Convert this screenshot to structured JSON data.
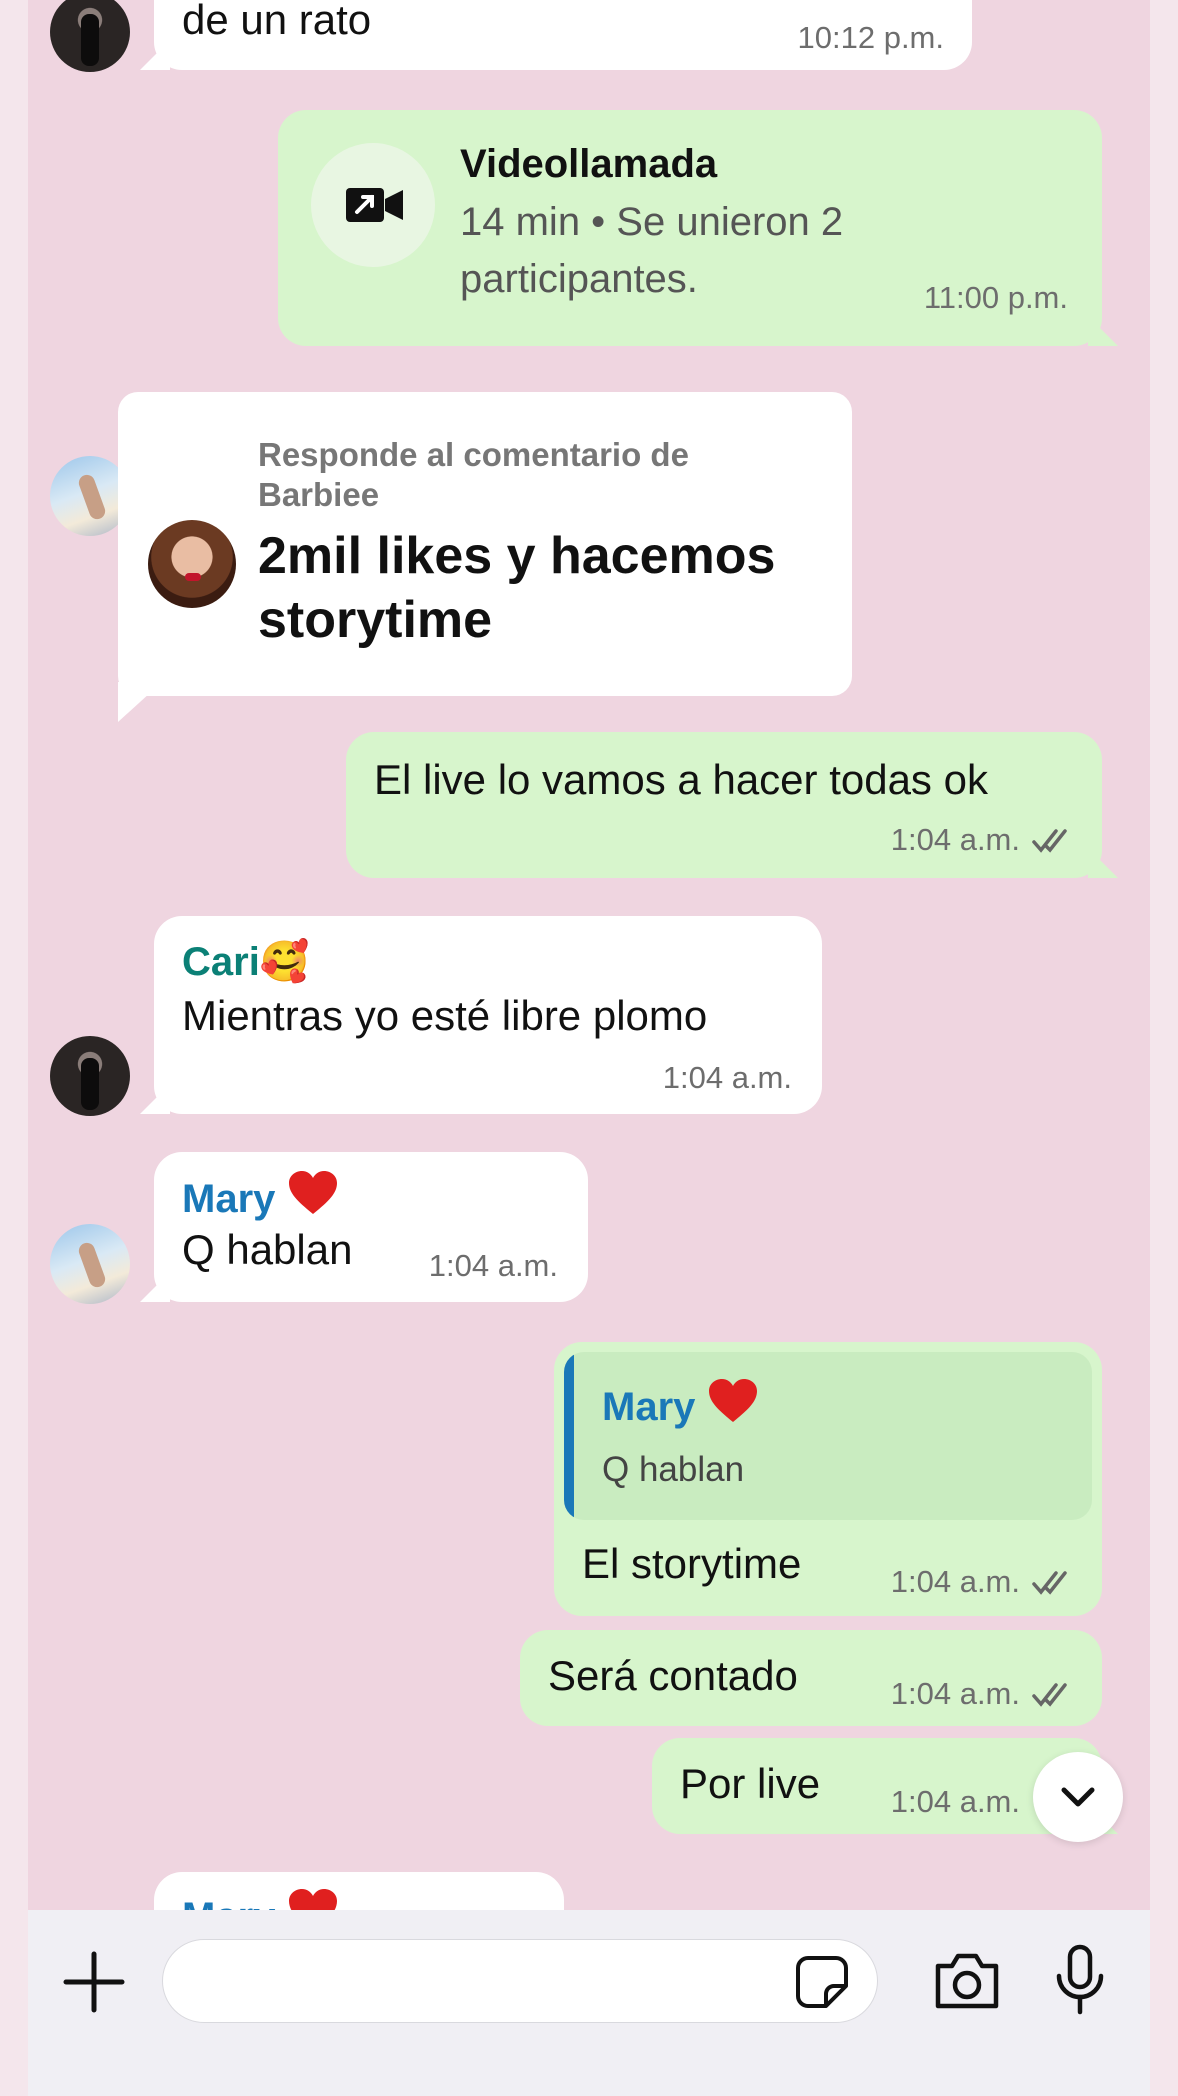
{
  "colors": {
    "chat_background": "#efd5e0",
    "incoming_bubble": "#ffffff",
    "outgoing_bubble": "#d7f5cc",
    "cari_name": "#0b8076",
    "mary_name": "#1a78b8",
    "quote_bar": "#1a78b8"
  },
  "messages": {
    "m1": {
      "text": "de un rato",
      "time": "10:12 p.m."
    },
    "call": {
      "title": "Videollamada",
      "line1": "14 min • Se unieron 2",
      "line2": "participantes.",
      "time": "11:00 p.m."
    },
    "reply_card": {
      "label_line1": "Responde al comentario de",
      "label_line2": "Barbiee",
      "line1": "2mil likes y hacemos",
      "line2": "storytime"
    },
    "m3": {
      "text": "El live lo vamos a hacer todas ok",
      "time": "1:04 a.m."
    },
    "m4": {
      "sender": "Cari🥰",
      "text": "Mientras yo esté libre plomo",
      "time": "1:04 a.m."
    },
    "m5": {
      "sender": "Mary",
      "text": "Q hablan",
      "time": "1:04 a.m."
    },
    "m6": {
      "quote_sender": "Mary",
      "quote_text": "Q hablan",
      "text": "El storytime",
      "time": "1:04 a.m."
    },
    "m7": {
      "text": "Será contado",
      "time": "1:04 a.m."
    },
    "m8": {
      "text": "Por live",
      "time": "1:04 a.m."
    },
    "m9": {
      "sender": "Mary"
    }
  },
  "icons": {
    "call": "video-call-icon",
    "checks": "double-check-icon",
    "scroll": "chevron-down-icon",
    "add": "plus-icon",
    "sticker": "sticker-icon",
    "camera": "camera-icon",
    "mic": "microphone-icon"
  }
}
